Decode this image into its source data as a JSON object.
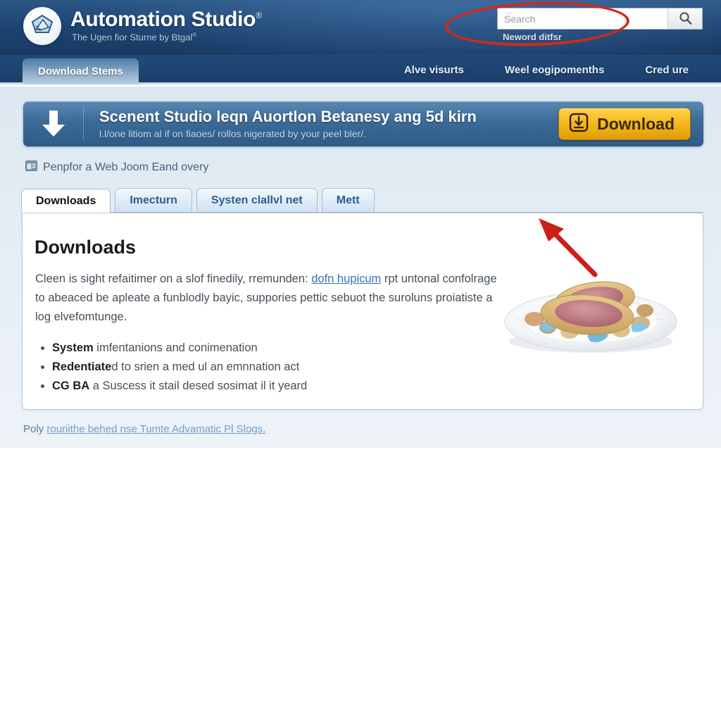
{
  "header": {
    "logo_icon": "shield-logo-icon",
    "brand_title": "Automation Studio",
    "brand_registered": "®",
    "brand_tagline": "The Ugen fior Sturne by Btgal",
    "brand_tagline_sup": "®"
  },
  "search": {
    "placeholder": "Search",
    "value": "",
    "button_icon": "search-icon",
    "note": "Neword ditfsr",
    "annotation": "red-ellipse-highlight"
  },
  "navbar": {
    "active_tab": "Download Stems",
    "links": [
      {
        "label": "Alve visurts"
      },
      {
        "label": "Weel eogipomenths"
      },
      {
        "label": "Cred ure"
      }
    ]
  },
  "banner": {
    "arrow_icon": "download-arrow-icon",
    "title": "Scenent Studio leqn Auortlon Betanesy ang 5d kirn",
    "subtitle": "l.l/one litiom al if on fiaoes/ rollos nigerated by your peel bler/.",
    "button_label": "Download",
    "button_icon": "download-circle-icon"
  },
  "breadcrumb": {
    "icon": "page-window-icon",
    "label": "Penpfor a Web Joom Eand overy"
  },
  "tabs": [
    {
      "label": "Downloads",
      "active": true
    },
    {
      "label": "Imecturn",
      "active": false
    },
    {
      "label": "Systen clallvl net",
      "active": false
    },
    {
      "label": "Mett",
      "active": false
    }
  ],
  "content": {
    "title": "Downloads",
    "paragraph_part1": "Cleen is sight refaitimer on a slof finedily, rremunden: ",
    "paragraph_link": "dofn hupicum",
    "paragraph_part2": " rpt untonal confolrage to abeaced be apleate a funblodly bayic, suppories pettic sebuot the suroluns proiatiste a log elvefomtunge.",
    "bullets": [
      {
        "strong": "System",
        "rest": " imfentanions and conimenation"
      },
      {
        "strong": "Redentiate",
        "rest": "d to srien a med ul an emnnation act"
      },
      {
        "strong": "CG BA",
        "rest": " a Suscess it stail desed sosimat il it yeard"
      }
    ],
    "image_alt": "plate-of-food-image"
  },
  "annotation": {
    "arrow": "red-pointer-arrow"
  },
  "footer": {
    "prefix": "Poly ",
    "link": "rouriithe behed nse Tumte Advamatic Pl Slogs."
  },
  "colors": {
    "header_blue": "#1e4474",
    "accent_gold": "#f5b81d",
    "annotation_red": "#d0291f",
    "link_blue": "#3573b6",
    "page_bg": "#e5edf5"
  }
}
